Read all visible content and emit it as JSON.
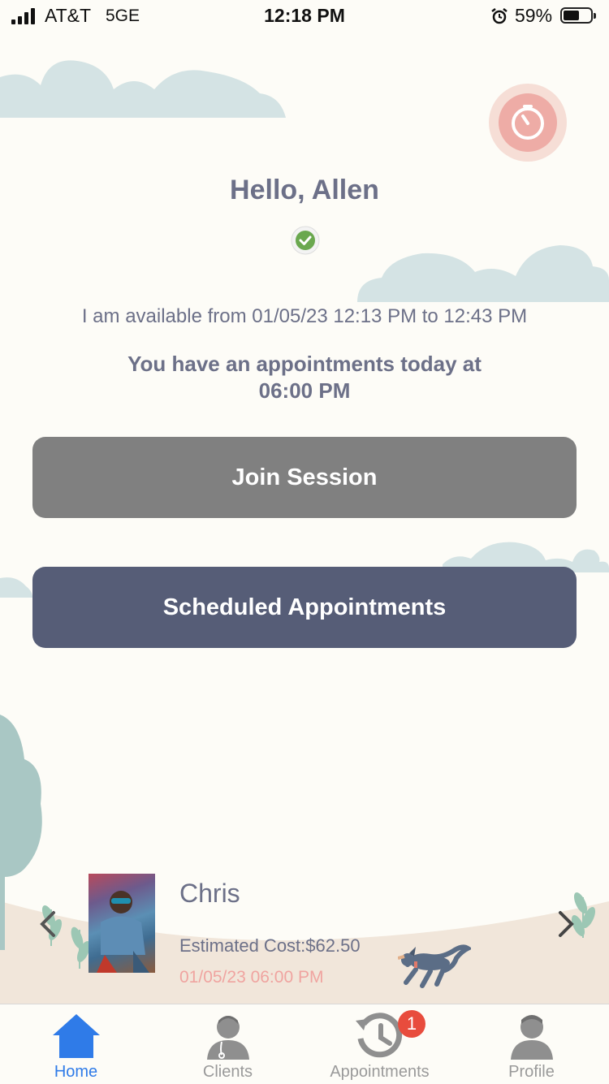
{
  "status_bar": {
    "carrier": "AT&T",
    "network": "5GE",
    "time": "12:18 PM",
    "battery": "59%",
    "battery_level": 0.59
  },
  "greeting": "Hello, Allen",
  "availability": "I am available from 01/05/23 12:13 PM to 12:43 PM",
  "appointment_message": {
    "line1": "You have an appointments today at",
    "line2": "06:00 PM"
  },
  "buttons": {
    "join_session": "Join Session",
    "scheduled_appointments": "Scheduled Appointments"
  },
  "appointment_card": {
    "name": "Chris",
    "estimated_cost": "Estimated Cost:$62.50",
    "datetime": "01/05/23 06:00 PM"
  },
  "tabs": [
    {
      "label": "Home",
      "icon": "home-icon",
      "active": true
    },
    {
      "label": "Clients",
      "icon": "clients-icon",
      "active": false
    },
    {
      "label": "Appointments",
      "icon": "appointments-history-icon",
      "active": false
    },
    {
      "label": "Profile",
      "icon": "profile-icon",
      "active": false
    }
  ],
  "appointments_badge": "1",
  "colors": {
    "background": "#fdfcf7",
    "accent": "#2f7be8",
    "text": "#6c7088",
    "join_button": "#808080",
    "scheduled_button": "#565d77",
    "badge": "#e84c3d",
    "date_text": "#f0a4a0",
    "status_ok": "#6aa84f"
  }
}
